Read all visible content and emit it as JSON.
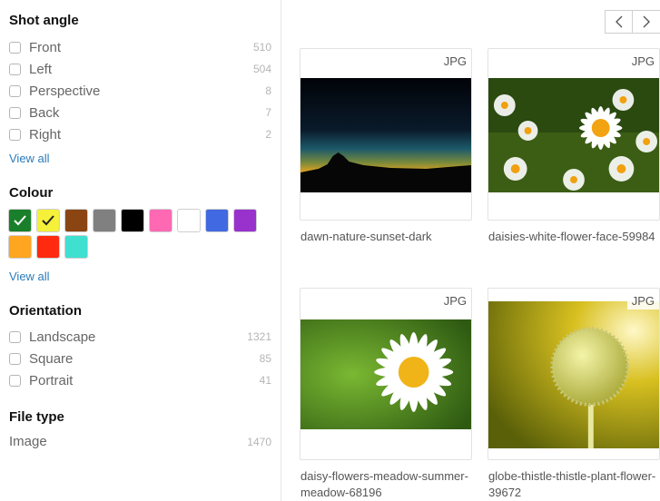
{
  "filters": {
    "shot_angle": {
      "title": "Shot angle",
      "options": [
        {
          "label": "Front",
          "count": "510"
        },
        {
          "label": "Left",
          "count": "504"
        },
        {
          "label": "Perspective",
          "count": "8"
        },
        {
          "label": "Back",
          "count": "7"
        },
        {
          "label": "Right",
          "count": "2"
        }
      ],
      "view_all": "View all"
    },
    "colour": {
      "title": "Colour",
      "swatches": [
        {
          "color": "#1a7f2a",
          "selected": true
        },
        {
          "color": "#f5f03a",
          "selected": true
        },
        {
          "color": "#8b4513",
          "selected": false
        },
        {
          "color": "#808080",
          "selected": false
        },
        {
          "color": "#000000",
          "selected": false
        },
        {
          "color": "#ff69b4",
          "selected": false
        },
        {
          "color": "#ffffff",
          "selected": false
        },
        {
          "color": "#4169e1",
          "selected": false
        },
        {
          "color": "#9932cc",
          "selected": false
        },
        {
          "color": "#ffa520",
          "selected": false
        },
        {
          "color": "#ff2a10",
          "selected": false
        },
        {
          "color": "#40e0d0",
          "selected": false
        }
      ],
      "view_all": "View all"
    },
    "orientation": {
      "title": "Orientation",
      "options": [
        {
          "label": "Landscape",
          "count": "1321"
        },
        {
          "label": "Square",
          "count": "85"
        },
        {
          "label": "Portrait",
          "count": "41"
        }
      ]
    },
    "file_type": {
      "title": "File type",
      "options": [
        {
          "label": "Image",
          "count": "1470"
        }
      ]
    }
  },
  "pagination": {
    "prev_icon": "chevron-left-icon",
    "next_icon": "chevron-right-icon"
  },
  "results": [
    {
      "badge": "JPG",
      "caption": "dawn-nature-sunset-dark"
    },
    {
      "badge": "JPG",
      "caption": "daisies-white-flower-face-59984"
    },
    {
      "badge": "JPG",
      "caption": "daisy-flowers-meadow-summer-meadow-68196"
    },
    {
      "badge": "JPG",
      "caption": "globe-thistle-thistle-plant-flower-39672"
    }
  ]
}
